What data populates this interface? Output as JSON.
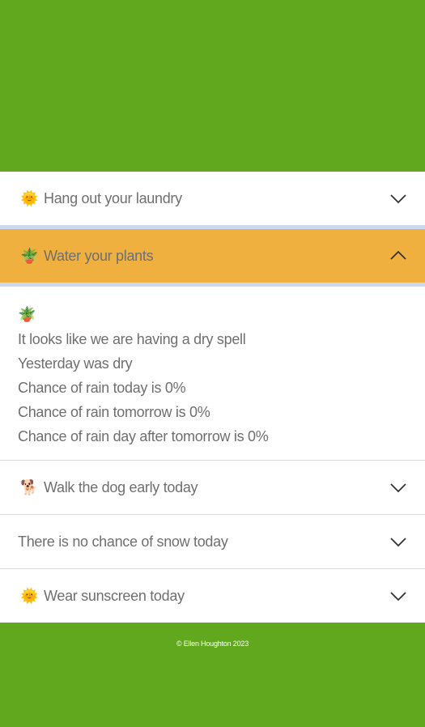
{
  "accordion": {
    "items": [
      {
        "emoji": "🌞",
        "label": "Hang out your laundry",
        "icon": "chevron-down-icon"
      },
      {
        "emoji": "🪴",
        "label": "Water your plants",
        "icon": "chevron-up-icon",
        "expanded": true,
        "body": {
          "emoji": "🪴",
          "lines": [
            "It looks like we are having a dry spell",
            "Yesterday was dry",
            "Chance of rain today is 0%",
            "Chance of rain tomorrow is 0%",
            "Chance of rain day after tomorrow is 0%"
          ]
        }
      },
      {
        "emoji": "🐕",
        "label": "Walk the dog early today",
        "icon": "chevron-down-icon"
      },
      {
        "emoji": "",
        "label": "There is no chance of snow today",
        "icon": "chevron-down-icon"
      },
      {
        "emoji": "🌞",
        "label": "Wear sunscreen today",
        "icon": "chevron-down-icon"
      }
    ]
  },
  "footer": {
    "text": "© Ellen Houghton 2023"
  },
  "colors": {
    "background": "#61a81e",
    "expanded_header": "#f0b03f",
    "separator_blue": "#c9d8f0"
  }
}
